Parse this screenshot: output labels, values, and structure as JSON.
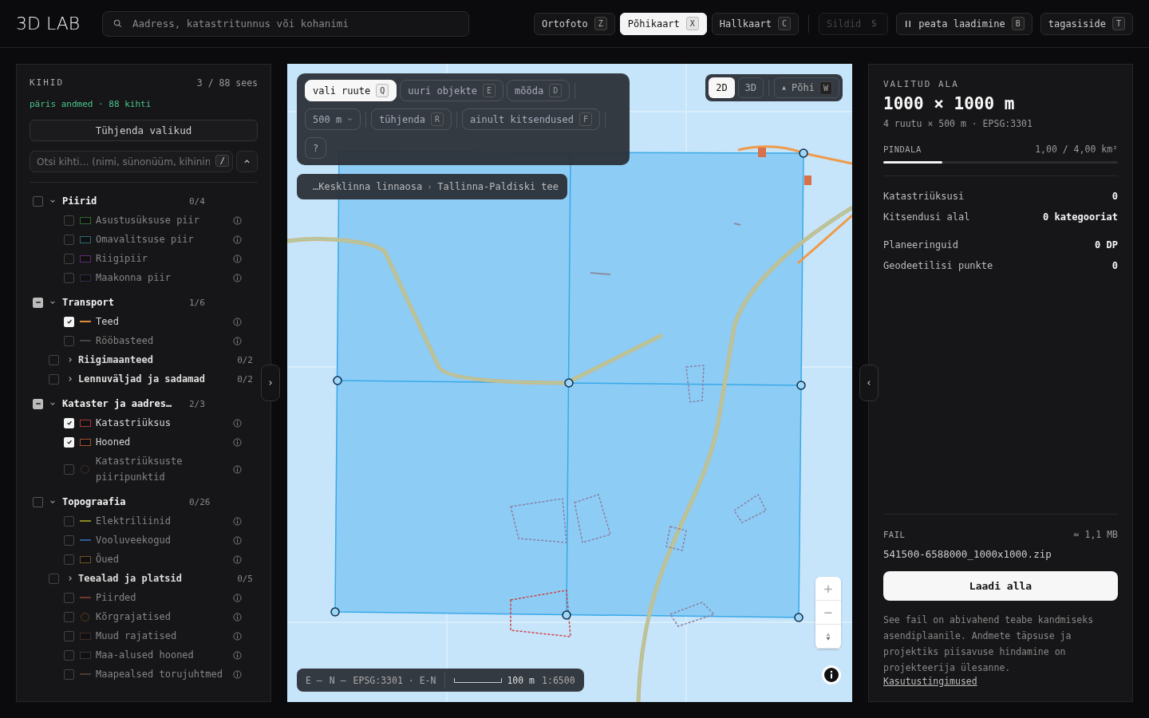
{
  "header": {
    "logo": "3D LAB",
    "search": {
      "placeholder": "Aadress, katastritunnus või kohanimi"
    },
    "basemaps": [
      {
        "label": "Ortofoto",
        "key": "Z",
        "selected": false
      },
      {
        "label": "Põhikaart",
        "key": "X",
        "selected": true
      },
      {
        "label": "Hallkaart",
        "key": "C",
        "selected": false
      }
    ],
    "labels_toggle": {
      "label": "Sildid",
      "key": "S",
      "disabled": true
    },
    "actions": [
      {
        "kind": "pause",
        "label": "peata laadimine",
        "key": "B"
      },
      {
        "kind": "plain",
        "label": "tagasiside",
        "key": "T"
      }
    ]
  },
  "layers_panel": {
    "title": "KIHID",
    "count": "3 / 88 sees",
    "source": "päris andmed · 88 kihti",
    "clear_button": "Tühjenda valikud",
    "search": {
      "placeholder": "Otsi kihti… (nimi, sünonüüm, kihinin",
      "key": "/"
    },
    "groups": [
      {
        "name": "Piirid",
        "count": "0/4",
        "indeterminate": false,
        "expanded": true,
        "children": [
          {
            "kind": "box",
            "label": "Asustusüksuse piir",
            "checked": false,
            "color": "#2f6b30"
          },
          {
            "kind": "box",
            "label": "Omavalitsuse piir",
            "checked": false,
            "color": "#2b6a72"
          },
          {
            "kind": "box",
            "label": "Riigipiir",
            "checked": false,
            "color": "#5c2b6e"
          },
          {
            "kind": "box",
            "label": "Maakonna piir",
            "checked": false,
            "color": "#2b2f48"
          }
        ]
      },
      {
        "name": "Transport",
        "count": "1/6",
        "indeterminate": true,
        "expanded": true,
        "children": [
          {
            "kind": "line",
            "label": "Teed",
            "checked": true,
            "color": "#e08a3c"
          },
          {
            "kind": "line",
            "label": "Rööbasteed",
            "checked": false,
            "color": "#444448"
          },
          {
            "kind": "group",
            "label": "Riigimaanteed",
            "count": "0/2",
            "checked": false,
            "expanded": false
          },
          {
            "kind": "group",
            "label": "Lennuväljad ja sadamad",
            "count": "0/2",
            "checked": false,
            "expanded": false
          }
        ]
      },
      {
        "name": "Kataster ja aadres…",
        "count": "2/3",
        "indeterminate": true,
        "expanded": true,
        "children": [
          {
            "kind": "box",
            "label": "Katastriüksus",
            "checked": true,
            "color": "#a8383c"
          },
          {
            "kind": "box",
            "label": "Hooned",
            "checked": true,
            "color": "#a4502c"
          },
          {
            "kind": "dot",
            "label": "Katastriüksuste piiripunktid",
            "checked": false,
            "color": "#3c302c"
          }
        ]
      },
      {
        "name": "Topograafia",
        "count": "0/26",
        "indeterminate": false,
        "expanded": true,
        "children": [
          {
            "kind": "line",
            "label": "Elektriliinid",
            "checked": false,
            "color": "#8a8a22"
          },
          {
            "kind": "line",
            "label": "Vooluveekogud",
            "checked": false,
            "color": "#2a5c9c"
          },
          {
            "kind": "box",
            "label": "Õued",
            "checked": false,
            "color": "#6c5222"
          },
          {
            "kind": "group",
            "label": "Teealad ja platsid",
            "count": "0/5",
            "checked": false,
            "expanded": false
          },
          {
            "kind": "line",
            "label": "Piirded",
            "checked": false,
            "color": "#6c3a2a"
          },
          {
            "kind": "dot",
            "label": "Kõrgrajatised",
            "checked": false,
            "color": "#5c3a1c"
          },
          {
            "kind": "box",
            "label": "Muud rajatised",
            "checked": false,
            "color": "#3c2c24"
          },
          {
            "kind": "box",
            "label": "Maa-alused hooned",
            "checked": false,
            "color": "#363638"
          },
          {
            "kind": "line",
            "label": "Maapealsed torujuhtmed",
            "checked": false,
            "color": "#4c3a30"
          }
        ]
      }
    ]
  },
  "map": {
    "toolbar": {
      "modes": [
        {
          "label": "vali ruute",
          "key": "Q",
          "selected": true
        },
        {
          "label": "uuri objekte",
          "key": "E",
          "selected": false
        },
        {
          "label": "mõõda",
          "key": "D",
          "selected": false
        }
      ],
      "grid_size": "500 m",
      "clear": {
        "label": "tühjenda",
        "key": "R"
      },
      "restrictions_only": {
        "label": "ainult kitsendused",
        "key": "F",
        "on": false
      },
      "help": "?"
    },
    "breadcrumb": [
      "…Kesklinna linnaosa",
      "Tallinna-Paldiski tee"
    ],
    "view_modes": [
      {
        "label": "2D",
        "selected": true
      },
      {
        "label": "3D",
        "selected": false
      }
    ],
    "north": {
      "label": "Põhi",
      "key": "W"
    },
    "zoom": {
      "in": "+",
      "out": "−"
    },
    "coordinates": {
      "east": "E —",
      "north": "N —",
      "crs": "EPSG:3301 · E-N"
    },
    "scale": {
      "distance": "100 m",
      "ratio": "1:6500"
    }
  },
  "selection_panel": {
    "title": "VALITUD ALA",
    "size": "1000 × 1000 m",
    "details": "4 ruutu × 500 m · EPSG:3301",
    "area": {
      "label": "PINDALA",
      "reading": "1,00 / 4,00 km²",
      "level": 0.25
    },
    "stats": [
      {
        "label": "Katastriüksusi",
        "value": "0"
      },
      {
        "label": "Kitsendusi alal",
        "value": "0 kategooriat"
      },
      {
        "label": "Planeeringuid",
        "value": "0 DP"
      },
      {
        "label": "Geodeetilisi punkte",
        "value": "0"
      }
    ],
    "file": {
      "label": "FAIL",
      "size": "≈ 1,1 MB",
      "name": "541500-6588000_1000x1000.zip"
    },
    "download_button": "Laadi alla",
    "note": "See fail on abivahend teabe kandmiseks asendiplaanile. Andmete täpsuse ja projektiks piisavuse hindamine on projekteerija ülesanne.",
    "terms_link": "Kasutustingimused"
  }
}
